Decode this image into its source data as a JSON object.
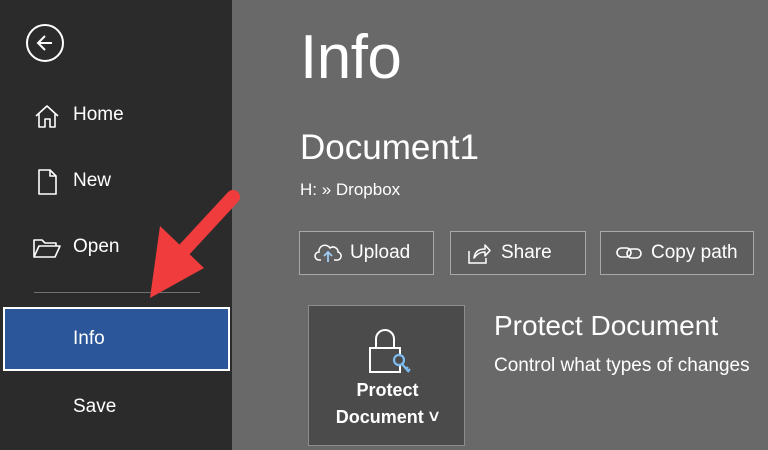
{
  "sidebar": {
    "back_icon": "arrow-left-circle-icon",
    "items": [
      {
        "label": "Home",
        "icon": "home-icon"
      },
      {
        "label": "New",
        "icon": "new-document-icon"
      },
      {
        "label": "Open",
        "icon": "folder-open-icon"
      },
      {
        "label": "Info",
        "active": true
      },
      {
        "label": "Save"
      }
    ]
  },
  "main": {
    "title": "Info",
    "document_name": "Document1",
    "document_path": "H: » Dropbox",
    "actions": [
      {
        "label": "Upload",
        "icon": "cloud-upload-icon"
      },
      {
        "label": "Share",
        "icon": "share-icon"
      },
      {
        "label": "Copy path",
        "icon": "link-icon"
      }
    ],
    "protect": {
      "tile_line1": "Protect",
      "tile_line2": "Document ˅",
      "heading": "Protect Document",
      "description": "Control what types of changes",
      "icon": "lock-key-icon"
    }
  },
  "colors": {
    "sidebar_bg": "#2b2b2b",
    "main_bg": "#696969",
    "active_item": "#2b579a",
    "annotation_arrow": "#f03c3c"
  }
}
